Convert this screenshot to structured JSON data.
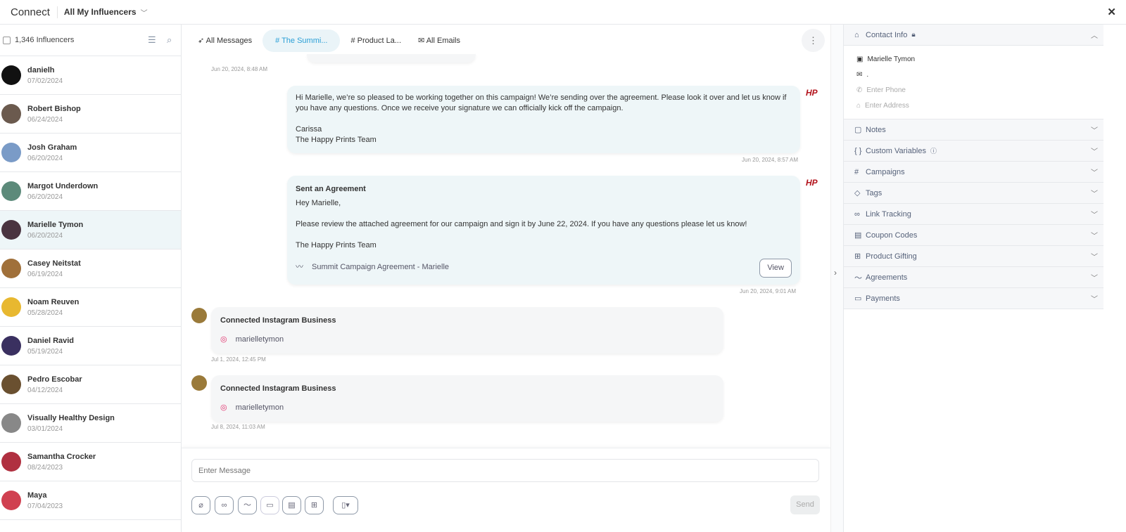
{
  "topbar": {
    "title": "Connect",
    "scope": "All My Influencers"
  },
  "left": {
    "count": "1,346 Influencers",
    "items": [
      {
        "name": "danielh",
        "date": "07/02/2024",
        "color": "#111"
      },
      {
        "name": "Robert Bishop",
        "date": "06/24/2024",
        "color": "#6b5a4e"
      },
      {
        "name": "Josh Graham",
        "date": "06/20/2024",
        "color": "#7a9bc7"
      },
      {
        "name": "Margot Underdown",
        "date": "06/20/2024",
        "color": "#5c8a7a"
      },
      {
        "name": "Marielle Tymon",
        "date": "06/20/2024",
        "color": "#4a3440"
      },
      {
        "name": "Casey Neitstat",
        "date": "06/19/2024",
        "color": "#a0703a"
      },
      {
        "name": "Noam Reuven",
        "date": "05/28/2024",
        "color": "#e8b830"
      },
      {
        "name": "Daniel Ravid",
        "date": "05/19/2024",
        "color": "#3a3060"
      },
      {
        "name": "Pedro Escobar",
        "date": "04/12/2024",
        "color": "#6a5030"
      },
      {
        "name": "Visually Healthy Design",
        "date": "03/01/2024",
        "color": "#888"
      },
      {
        "name": "Samantha Crocker",
        "date": "08/24/2023",
        "color": "#b03040"
      },
      {
        "name": "Maya",
        "date": "07/04/2023",
        "color": "#d04050"
      }
    ]
  },
  "tabs": [
    {
      "label": "All Messages",
      "icon": "send-icon"
    },
    {
      "label": "The Summi...",
      "icon": "hashtag-icon"
    },
    {
      "label": "Product La...",
      "icon": "hashtag-icon"
    },
    {
      "label": "All Emails",
      "icon": "mail-icon"
    }
  ],
  "messages": {
    "ts0": "Jun 20, 2024, 8:48 AM",
    "m1": {
      "lines": [
        "Hi Marielle, we’re so pleased to be working together on this campaign! We’re sending over the agreement. Please look it over and let us know if you have any questions. Once we receive your signature we can officially kick off the campaign.",
        "Carissa",
        "The Happy Prints Team"
      ],
      "ts": "Jun 20, 2024, 8:57 AM"
    },
    "m2": {
      "title": "Sent an Agreement",
      "lines": [
        "Hey Marielle,",
        "Please review the attached agreement for our campaign and sign it by June 22, 2024. If you have any questions please let us know!",
        "The Happy Prints Team"
      ],
      "attachment": "Summit Campaign Agreement - Marielle",
      "view": "View",
      "ts": "Jun 20, 2024, 9:01 AM"
    },
    "m3": {
      "title": "Connected Instagram Business",
      "handle": "marielletymon",
      "ts": "Jul 1, 2024, 12:45 PM"
    },
    "m4": {
      "title": "Connected Instagram Business",
      "handle": "marielletymon",
      "ts": "Jul 8, 2024, 11:03 AM"
    },
    "brand_logo": "HP"
  },
  "compose": {
    "placeholder": "Enter Message",
    "send": "Send"
  },
  "right": {
    "contact_title": "Contact Info",
    "name": "Marielle Tymon",
    "email": ".",
    "phone_placeholder": "Enter Phone",
    "address_placeholder": "Enter Address",
    "sections": [
      "Notes",
      "Custom Variables",
      "Campaigns",
      "Tags",
      "Link Tracking",
      "Coupon Codes",
      "Product Gifting",
      "Agreements",
      "Payments"
    ]
  },
  "colors": {
    "accent": "#2a9fd6",
    "selected_row": "#eef6f8",
    "brand": "#b3121b"
  }
}
